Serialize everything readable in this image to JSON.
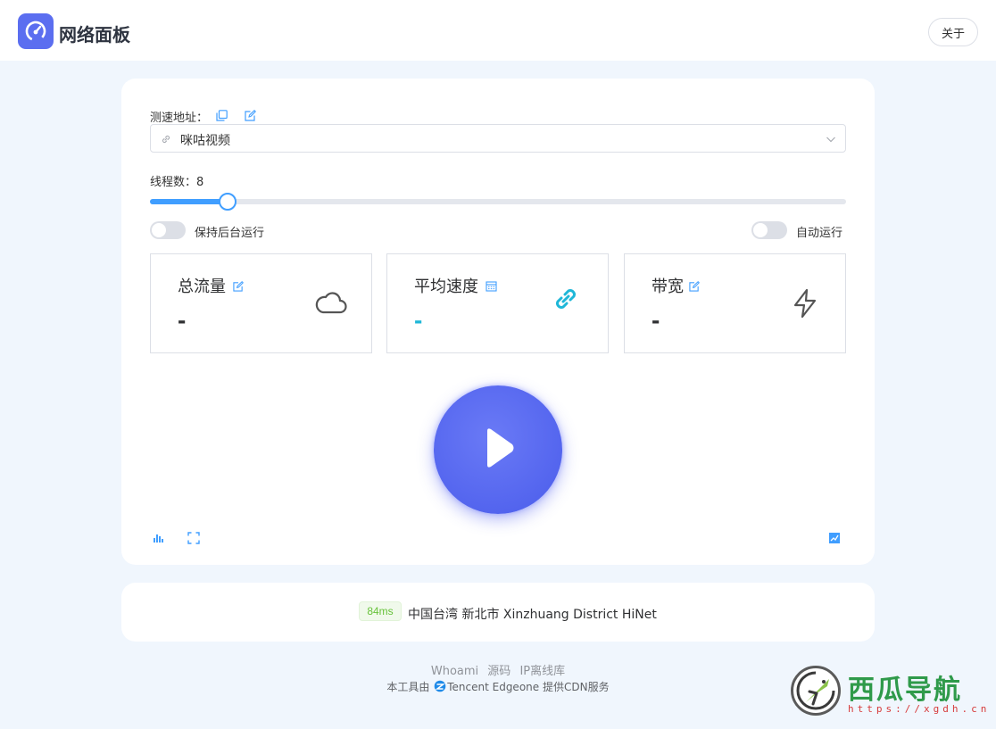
{
  "app": {
    "title": "网络面板",
    "about_label": "关于"
  },
  "test_url": {
    "label": "测速地址：",
    "selected": "咪咕视频"
  },
  "threads": {
    "label": "线程数：",
    "value": 8,
    "min": 1,
    "max": 64
  },
  "toggles": {
    "background_run": {
      "label": "保持后台运行",
      "on": false
    },
    "auto_run": {
      "label": "自动运行",
      "on": false
    }
  },
  "stats": [
    {
      "title": "总流量",
      "value": "-",
      "icon": "cloud-icon",
      "color": "#303133"
    },
    {
      "title": "平均速度",
      "value": "-",
      "icon": "link-icon",
      "color": "#1fb7d8"
    },
    {
      "title": "带宽",
      "value": "-",
      "icon": "lightning-icon",
      "color": "#303133"
    }
  ],
  "connection": {
    "ping": "84ms",
    "location": "中国台湾 新北市 Xinzhuang District HiNet"
  },
  "footer": {
    "links": [
      "Whoami",
      "源码",
      "IP离线库"
    ],
    "cdn_prefix": "本工具由",
    "cdn_brand": "Tencent Edgeone",
    "cdn_suffix": "提供CDN服务"
  },
  "watermark": {
    "title": "西瓜导航",
    "url": "https://xgdh.cn"
  },
  "colors": {
    "accent": "#409eff",
    "brand": "#5b6ef0",
    "play": "#4a5ceb",
    "ping_green": "#67c23a"
  }
}
